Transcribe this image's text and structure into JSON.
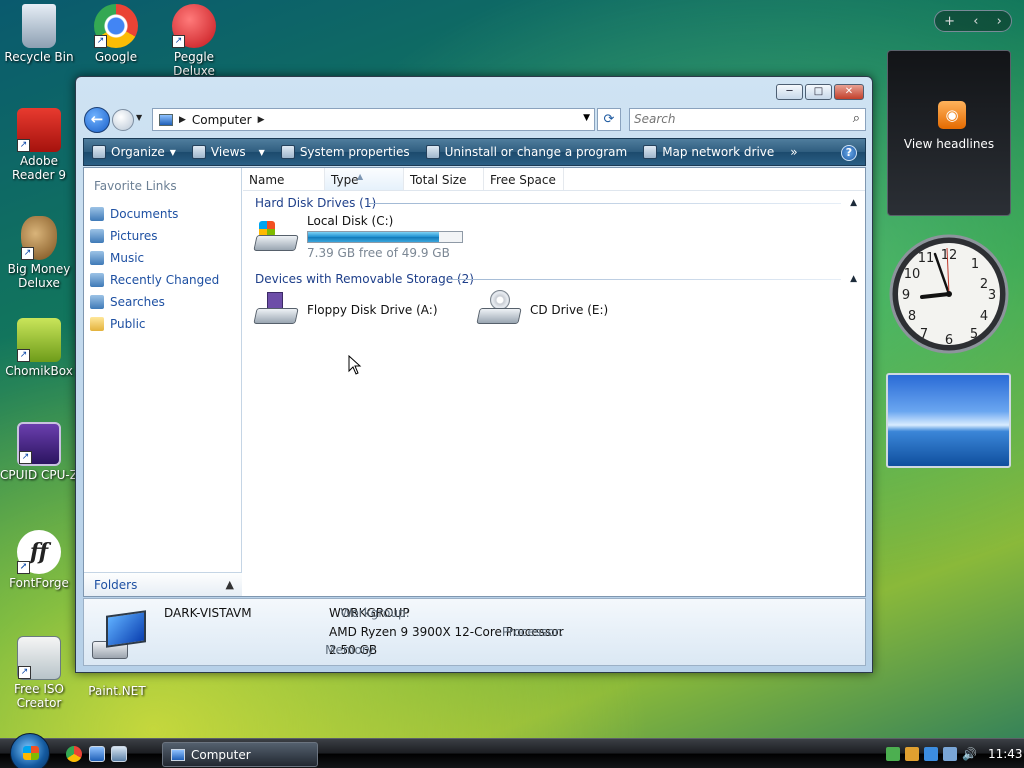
{
  "desktop": {
    "icons": [
      {
        "label": "Recycle Bin"
      },
      {
        "label": "Google Chrome"
      },
      {
        "label": "Peggle Deluxe"
      },
      {
        "label": "Adobe Reader 9"
      },
      {
        "label": "Big Money Deluxe"
      },
      {
        "label": "ChomikBox"
      },
      {
        "label": "CPUID CPU-Z"
      },
      {
        "label": "FontForge"
      },
      {
        "label": "Free ISO Creator"
      },
      {
        "label": "Paint.NET"
      }
    ]
  },
  "window": {
    "address_path": "Computer",
    "search_placeholder": "Search",
    "controls": {
      "minimize": "─",
      "maximize": "□",
      "close": "✕"
    },
    "toolbar": [
      {
        "label": "Organize",
        "has_caret": true
      },
      {
        "label": "Views",
        "has_caret": true
      },
      {
        "label": "System properties"
      },
      {
        "label": "Uninstall or change a program"
      },
      {
        "label": "Map network drive"
      },
      {
        "label": "»"
      }
    ],
    "help": "?",
    "nav_pane": {
      "title": "Favorite Links",
      "links": [
        "Documents",
        "Pictures",
        "Music",
        "Recently Changed",
        "Searches",
        "Public"
      ],
      "folders_label": "Folders"
    },
    "columns": [
      "Name",
      "Type",
      "Total Size",
      "Free Space"
    ],
    "groups": [
      {
        "title": "Hard Disk Drives (1)",
        "drives": [
          {
            "name": "Local Disk (C:)",
            "free_text": "7.39 GB free of 49.9 GB",
            "used_fraction": 0.852
          }
        ]
      },
      {
        "title": "Devices with Removable Storage (2)",
        "drives": [
          {
            "name": "Floppy Disk Drive (A:)"
          },
          {
            "name": "CD Drive (E:)"
          }
        ]
      }
    ],
    "details": {
      "computer_name": "DARK-VISTAVM",
      "workgroup_label": "Workgroup:",
      "workgroup": "WORKGROUP",
      "processor_label": "Processor:",
      "processor": "AMD Ryzen 9 3900X 12-Core Processor",
      "memory_label": "Memory:",
      "memory": "2.50 GB"
    }
  },
  "gadgets": {
    "feed_label": "View headlines",
    "top_controls": [
      "+",
      "‹",
      "›"
    ]
  },
  "taskbar": {
    "task_label": "Computer",
    "time": "11:43"
  },
  "colors": {
    "link": "#1e50a2",
    "group_title": "#1e3f8a",
    "capacity_fill": "#1d8fd0"
  }
}
